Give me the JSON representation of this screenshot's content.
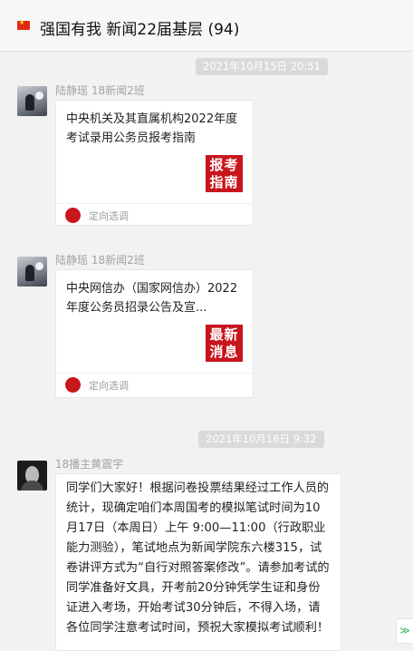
{
  "header": {
    "icon": "china-flag-icon",
    "title": "强国有我 新闻22届基层 (94)"
  },
  "messages": [
    {
      "timestamp": "2021年10月15日 20:51",
      "sender": "陆静瑶 18新闻2班",
      "avatar": "avatar-icon",
      "card": {
        "title": "中央机关及其直属机构2022年度考试录用公务员报考指南",
        "thumb_text": "报考指南",
        "source_icon": "source-logo-icon",
        "source": "定向选调"
      }
    },
    {
      "sender": "陆静瑶 18新闻2班",
      "avatar": "avatar-icon",
      "card": {
        "title": "中央网信办（国家网信办）2022年度公务员招录公告及宣...",
        "thumb_text": "最新消息",
        "source_icon": "source-logo-icon",
        "source": "定向选调"
      }
    },
    {
      "timestamp": "2021年10月16日 9:32",
      "sender": "18播主黄震宇",
      "avatar": "avatar-icon",
      "text": "同学们大家好！根据问卷投票结果经过工作人员的统计，现确定咱们本周国考的模拟笔试时间为10月17日（本周日）上午 9:00—11:00（行政职业能力测验），笔试地点为新闻学院东六楼315，试卷讲评方式为“自行对照答案修改”。请参加考试的同学准备好文具，开考前20分钟凭学生证和身份证进入考场，开始考试30分钟后，不得入场，请各位同学注意考试时间，预祝大家模拟考试顺利！"
    }
  ],
  "scroll_button": {
    "icon": "double-chevron-down-icon",
    "glyph": "≫"
  },
  "colors": {
    "background": "#f2f2f2",
    "timestamp_bg": "#dadada",
    "thumb_red": "#c8161d",
    "sender_gray": "#a3a3a3",
    "scroll_green": "#2fb34a"
  }
}
